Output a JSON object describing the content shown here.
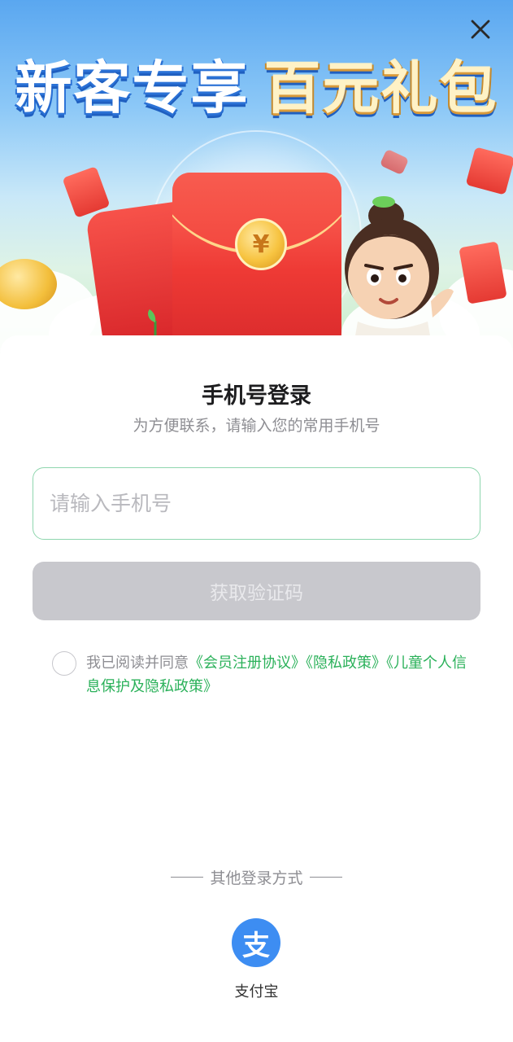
{
  "banner": {
    "headline_part1": "新客专享",
    "headline_part2": "百元礼包",
    "coin_symbol": "¥",
    "close_icon": "close-icon"
  },
  "login": {
    "title": "手机号登录",
    "subtitle": "为方便联系，请输入您的常用手机号",
    "phone_placeholder": "请输入手机号",
    "get_code_label": "获取验证码"
  },
  "agreement": {
    "prefix": "我已阅读并同意",
    "links": [
      "《会员注册协议》",
      "《隐私政策》",
      "《儿童个人信息保护及隐私政策》"
    ],
    "checked": false
  },
  "other_login": {
    "label": "其他登录方式",
    "providers": [
      {
        "icon": "alipay-icon",
        "glyph": "支",
        "label": "支付宝"
      }
    ]
  },
  "colors": {
    "accent_green": "#2bb15a",
    "input_border": "#8fd6ae",
    "disabled_button": "#c8c8cd",
    "alipay_blue": "#3d8df2"
  }
}
